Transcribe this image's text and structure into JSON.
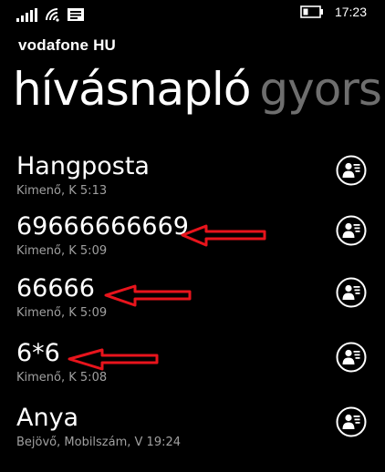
{
  "status_bar": {
    "time": "17:23",
    "icons": [
      "signal-icon",
      "wifi-icon",
      "message-icon",
      "battery-icon"
    ]
  },
  "carrier": "vodafone HU",
  "pivot": {
    "active": "hívásnapló",
    "next": "gyors"
  },
  "calls": [
    {
      "name": "Hangposta",
      "detail": "Kimenő, K 5:13"
    },
    {
      "name": "69666666669",
      "detail": "Kimenő, K 5:09"
    },
    {
      "name": "66666",
      "detail": "Kimenő, K 5:09"
    },
    {
      "name": "6*6",
      "detail": "Kimenő, K 5:08"
    },
    {
      "name": "Anya",
      "detail": "Bejövő, Mobilszám, V 19:24"
    }
  ],
  "colors": {
    "background": "#000000",
    "text": "#ffffff",
    "secondary_text": "#a0a0a0",
    "pivot_inactive": "#6e6e6e",
    "annotation_arrow": "#e8141c"
  }
}
